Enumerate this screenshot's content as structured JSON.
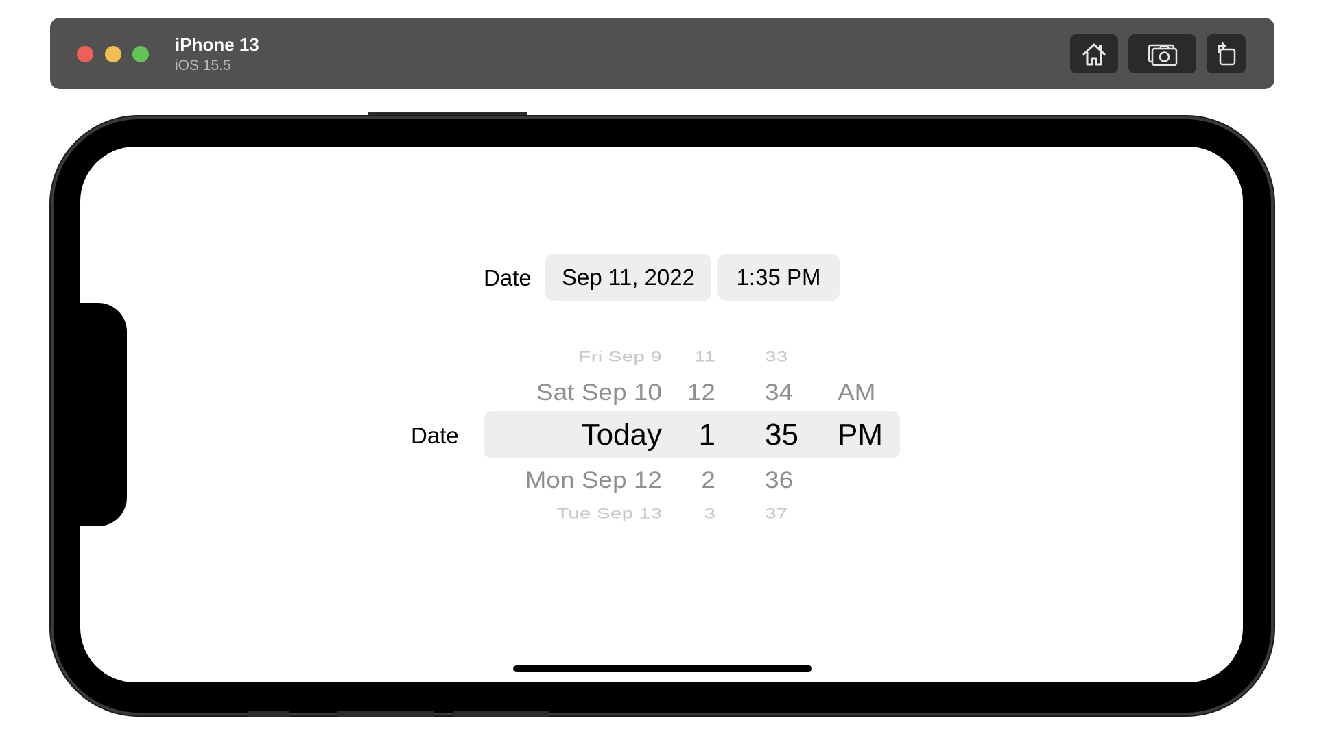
{
  "simulator": {
    "device_name": "iPhone 13",
    "os_version": "iOS 15.5",
    "toolbar": {
      "home_icon": "home-icon",
      "screenshot_icon": "camera-icon",
      "rotate_icon": "rotate-icon"
    },
    "window_controls": {
      "close_color": "#ee5f58",
      "minimize_color": "#f4bd4f",
      "zoom_color": "#61c454"
    }
  },
  "compact_picker": {
    "label": "Date",
    "date_value": "Sep 11, 2022",
    "time_value": "1:35 PM"
  },
  "wheel_picker": {
    "label": "Date",
    "days": [
      "Fri Sep 9",
      "Sat Sep 10",
      "Today",
      "Mon Sep 12",
      "Tue Sep 13"
    ],
    "hours": [
      "11",
      "12",
      "1",
      "2",
      "3"
    ],
    "minutes": [
      "33",
      "34",
      "35",
      "36",
      "37"
    ],
    "periods": [
      "AM",
      "PM"
    ],
    "selected_index": 2
  }
}
